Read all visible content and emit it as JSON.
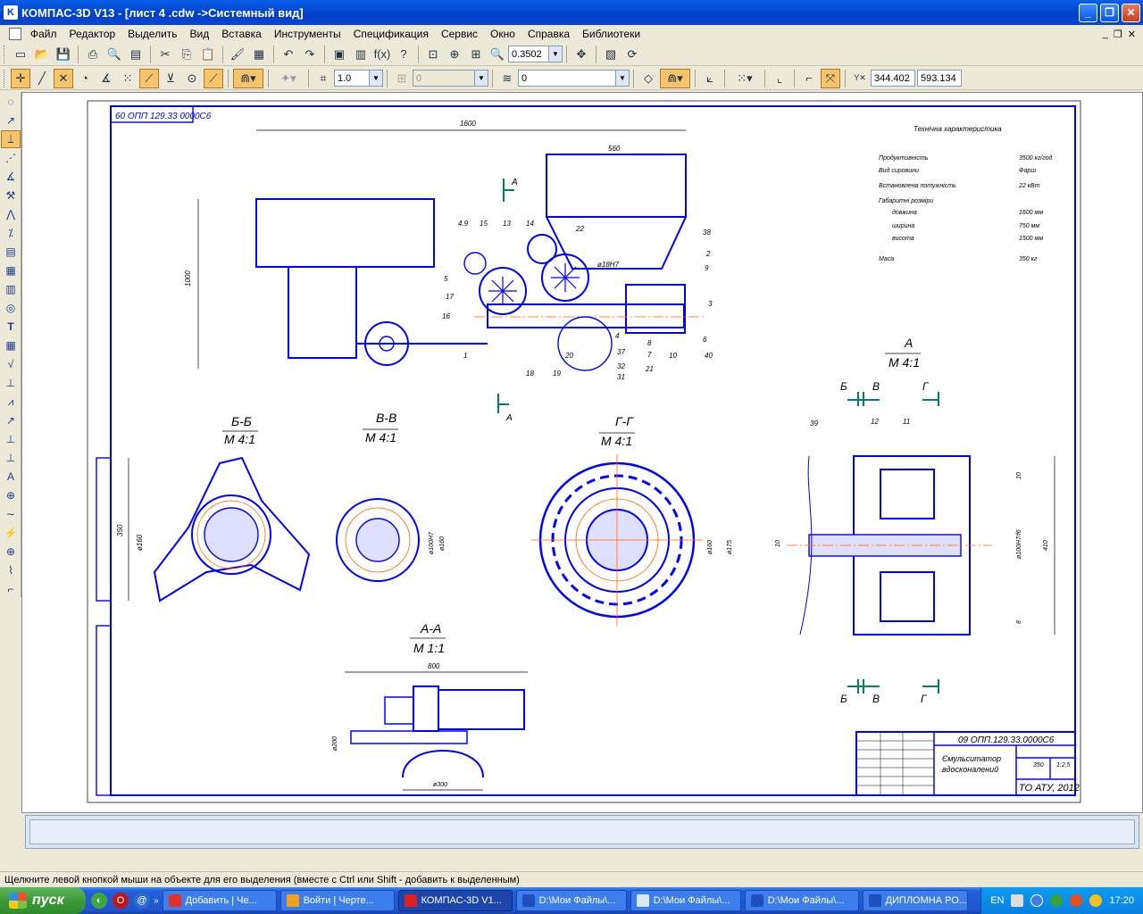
{
  "window": {
    "title": "КОМПАС-3D V13 - [лист 4 .cdw ->Системный вид]",
    "icon": "kompas-logo-icon"
  },
  "menu": [
    "Файл",
    "Редактор",
    "Выделить",
    "Вид",
    "Вставка",
    "Инструменты",
    "Спецификация",
    "Сервис",
    "Окно",
    "Справка",
    "Библиотеки"
  ],
  "toolbar1": {
    "zoom": "0.3502"
  },
  "toolbar2": {
    "line_scale": "1.0",
    "layer_field": "0",
    "state_field": "0",
    "coord_x": "344.402",
    "coord_y": "593.134"
  },
  "drawing": {
    "designation": "09 ОПП.129.33.0000С6",
    "designation_rotated": "60 ОПП 129.33 0000С6",
    "title_line1": "Ємульситатор",
    "title_line2": "вдосконалений",
    "org": "ТО АТУ, 2012",
    "mass": "350",
    "scale": "1:2,5",
    "tech_title": "Технічна характеристика",
    "tech_rows": [
      {
        "label": "Продуктивність",
        "value": "3500 кг/год"
      },
      {
        "label": "Вид сировини",
        "value": "Фарш"
      },
      {
        "label": "Встановлена потужність",
        "value": "22 кВт"
      },
      {
        "label": "Габаритні розміри",
        "value": ""
      },
      {
        "label": "довжина",
        "value": "1600 мм"
      },
      {
        "label": "ширина",
        "value": "750 мм"
      },
      {
        "label": "висота",
        "value": "1500 мм"
      },
      {
        "label": "Маса",
        "value": "350 кг"
      }
    ],
    "views": {
      "bb": {
        "title": "Б-Б",
        "scale": "М 4:1"
      },
      "vv": {
        "title": "В-В",
        "scale": "М 4:1"
      },
      "gg": {
        "title": "Г-Г",
        "scale": "М 4:1"
      },
      "a": {
        "title": "А",
        "scale": "М 4:1"
      },
      "aa": {
        "title": "А-А",
        "scale": "М 1:1"
      }
    },
    "section_letters": {
      "a": "А",
      "b": "Б",
      "v": "В",
      "g": "Г"
    },
    "dims": {
      "d1600": "1600",
      "d560": "560",
      "d1000": "1000",
      "d800": "800",
      "d350": "350",
      "d160a": "ø160",
      "d160b": "ø160",
      "d100h7": "ø100Н7",
      "d160c": "ø160",
      "d175": "ø175",
      "d410": "410",
      "d200": "ø200",
      "d300": "ø300",
      "d100h7f": "ø100Н7/f6",
      "d10": "10",
      "d8": "8",
      "d10l": "10"
    },
    "leaders": [
      "4.9",
      "15",
      "13",
      "14",
      "22",
      "38",
      "2",
      "9",
      "3",
      "5",
      "17",
      "16",
      "1",
      "18",
      "19",
      "20",
      "37",
      "32",
      "31",
      "21",
      "10",
      "40",
      "8",
      "7",
      "6",
      "4",
      "ø18Н7",
      "12",
      "11",
      "39"
    ]
  },
  "status": {
    "hint": "Щелкните левой кнопкой мыши на объекте для его выделения (вместе с Ctrl или Shift - добавить к выделенным)"
  },
  "taskbar": {
    "start": "пуск",
    "tasks": [
      "Добавить | Че...",
      "Войти | Черте...",
      "КОМПАС-3D V1...",
      "D:\\Мои Файлы\\...",
      "D:\\Мои Файлы\\...",
      "D:\\Мои Файлы\\...",
      "ДИПЛОМНА РО..."
    ],
    "lang": "EN",
    "clock": "17:20"
  }
}
